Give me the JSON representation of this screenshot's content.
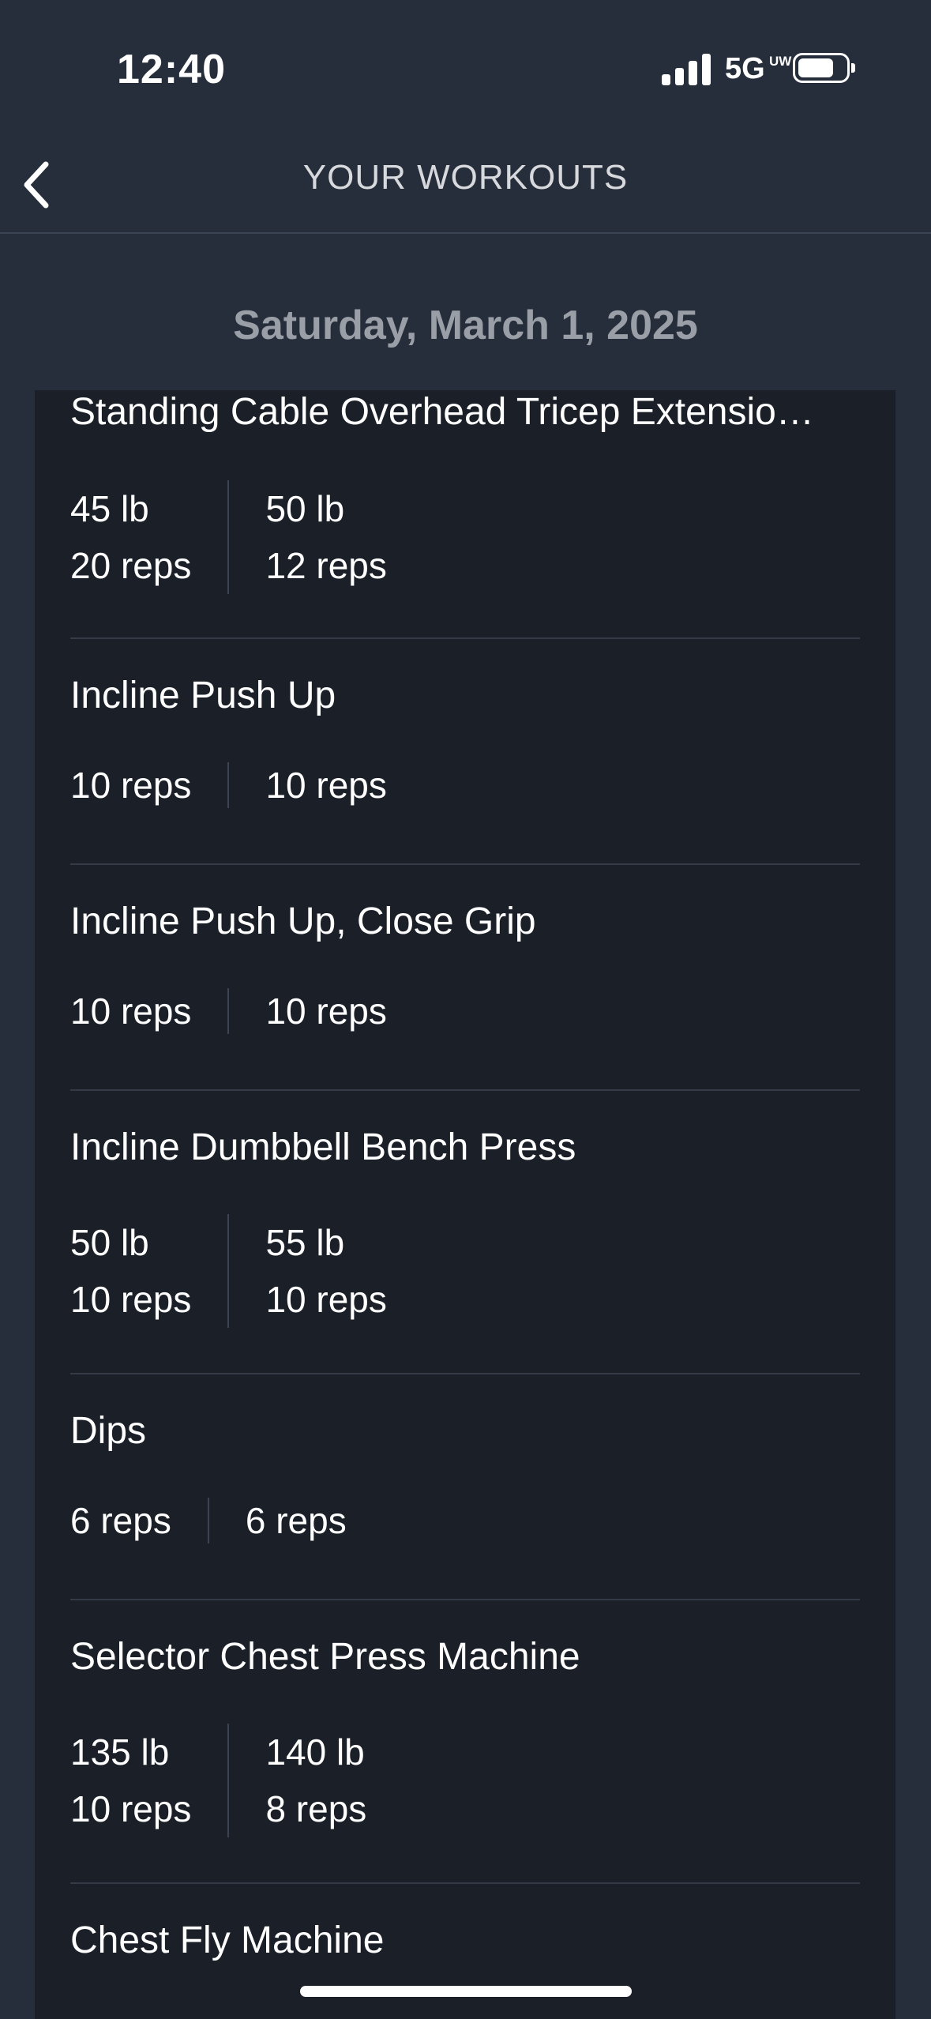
{
  "status": {
    "time": "12:40",
    "network": "5G",
    "network_badge": "UW"
  },
  "header": {
    "title": "YOUR WORKOUTS"
  },
  "date": "Saturday, March 1, 2025",
  "exercises": [
    {
      "name": "Standing Cable Overhead Tricep Extensio…",
      "sets": [
        {
          "weight": "45 lb",
          "reps": "20 reps"
        },
        {
          "weight": "50 lb",
          "reps": "12 reps"
        }
      ]
    },
    {
      "name": "Incline Push Up",
      "sets": [
        {
          "reps": "10 reps"
        },
        {
          "reps": "10 reps"
        }
      ]
    },
    {
      "name": "Incline Push Up, Close Grip",
      "sets": [
        {
          "reps": "10 reps"
        },
        {
          "reps": "10 reps"
        }
      ]
    },
    {
      "name": "Incline Dumbbell Bench Press",
      "sets": [
        {
          "weight": "50 lb",
          "reps": "10 reps"
        },
        {
          "weight": "55 lb",
          "reps": "10 reps"
        }
      ]
    },
    {
      "name": "Dips",
      "sets": [
        {
          "reps": "6 reps"
        },
        {
          "reps": "6 reps"
        }
      ]
    },
    {
      "name": "Selector Chest Press Machine",
      "sets": [
        {
          "weight": "135 lb",
          "reps": "10 reps"
        },
        {
          "weight": "140 lb",
          "reps": "8 reps"
        }
      ]
    },
    {
      "name": "Chest Fly Machine",
      "sets": []
    }
  ]
}
